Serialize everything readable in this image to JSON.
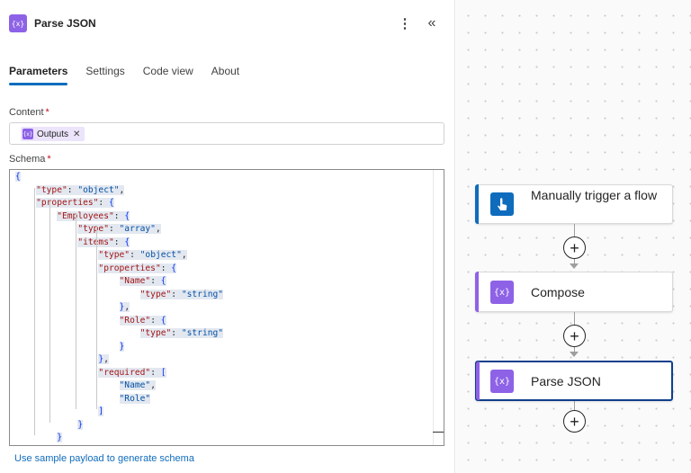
{
  "panel": {
    "title": "Parse JSON",
    "action_icon_glyph": "{x}",
    "more_icon_glyph": "⋮",
    "collapse_icon_glyph": "«",
    "tabs": [
      {
        "label": "Parameters",
        "active": true
      },
      {
        "label": "Settings",
        "active": false
      },
      {
        "label": "Code view",
        "active": false
      },
      {
        "label": "About",
        "active": false
      }
    ],
    "content": {
      "label": "Content",
      "required_mark": "*",
      "token": {
        "label": "Outputs",
        "icon_glyph": "{x}",
        "remove_glyph": "✕"
      }
    },
    "schema": {
      "label": "Schema",
      "required_mark": "*",
      "lines": [
        "{",
        "    \"type\": \"object\",",
        "    \"properties\": {",
        "        \"Employees\": {",
        "            \"type\": \"array\",",
        "            \"items\": {",
        "                \"type\": \"object\",",
        "                \"properties\": {",
        "                    \"Name\": {",
        "                        \"type\": \"string\"",
        "                    },",
        "                    \"Role\": {",
        "                        \"type\": \"string\"",
        "                    }",
        "                },",
        "                \"required\": [",
        "                    \"Name\",",
        "                    \"Role\"",
        "                ]",
        "            }",
        "        }"
      ]
    },
    "sample_link": "Use sample payload to generate schema"
  },
  "canvas": {
    "nodes": [
      {
        "label": "Manually trigger a flow",
        "kind": "trigger",
        "icon": "touch-icon",
        "color": "#0f6cbd"
      },
      {
        "label": "Compose",
        "kind": "action",
        "icon": "variable-icon",
        "color": "#8e62e7"
      },
      {
        "label": "Parse JSON",
        "kind": "action",
        "icon": "variable-icon",
        "color": "#8e62e7",
        "selected": true
      }
    ],
    "add_glyph": "+"
  },
  "colors": {
    "accent": "#0f6cbd",
    "data_operation": "#8e62e7",
    "selected_border": "#0f3f8c"
  }
}
